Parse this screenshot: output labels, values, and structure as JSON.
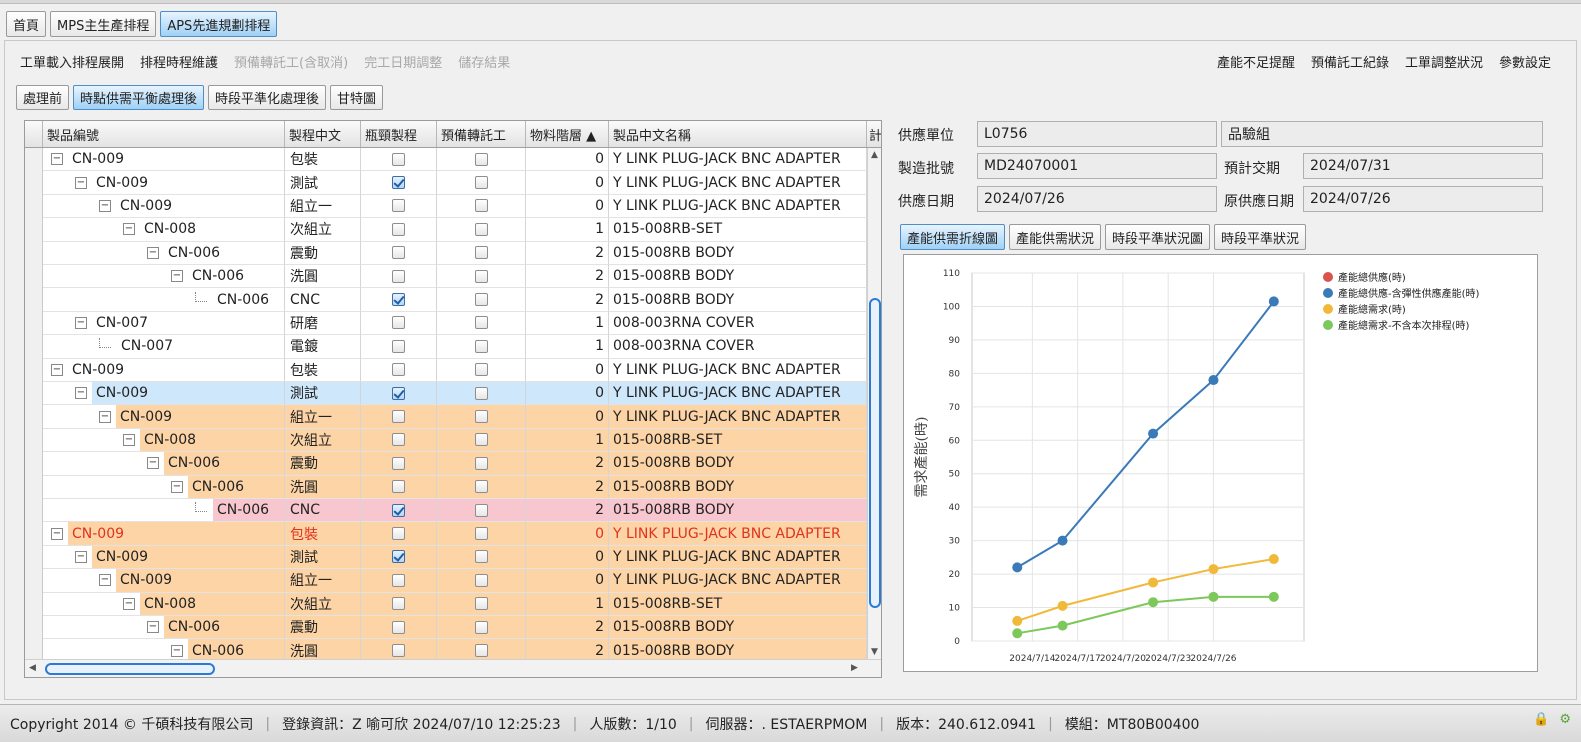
{
  "main_tabs": [
    "首頁",
    "MPS主生產排程",
    "APS先進規劃排程"
  ],
  "menu_left": [
    {
      "label": "工單載入排程展開",
      "enabled": true
    },
    {
      "label": "排程時程維護",
      "enabled": true
    },
    {
      "label": "預備轉託工(含取消)",
      "enabled": false
    },
    {
      "label": "完工日期調整",
      "enabled": false
    },
    {
      "label": "儲存結果",
      "enabled": false
    }
  ],
  "menu_right": [
    "產能不足提醒",
    "預備託工紀錄",
    "工單調整狀況",
    "參數設定"
  ],
  "sub_tabs": [
    "處理前",
    "時點供需平衡處理後",
    "時段平準化處理後",
    "甘特圖"
  ],
  "grid": {
    "headers": [
      "製品編號",
      "製程中文",
      "瓶頸製程",
      "預備轉託工",
      "物料階層 ▲",
      "製品中文名稱",
      "計"
    ],
    "rows": [
      {
        "prod": "CN-009",
        "depth": 0,
        "node": "exp",
        "proc": "包裝",
        "bottleneck": false,
        "outsource": false,
        "level": "0",
        "name": "Y LINK PLUG-JACK BNC ADAPTER",
        "style": "normal"
      },
      {
        "prod": "CN-009",
        "depth": 1,
        "node": "exp",
        "proc": "測試",
        "bottleneck": true,
        "outsource": false,
        "level": "0",
        "name": "Y LINK PLUG-JACK BNC ADAPTER",
        "style": "normal"
      },
      {
        "prod": "CN-009",
        "depth": 2,
        "node": "exp",
        "proc": "組立一",
        "bottleneck": false,
        "outsource": false,
        "level": "0",
        "name": "Y LINK PLUG-JACK BNC ADAPTER",
        "style": "normal"
      },
      {
        "prod": "CN-008",
        "depth": 3,
        "node": "exp",
        "proc": "次組立",
        "bottleneck": false,
        "outsource": false,
        "level": "1",
        "name": "015-008RB-SET",
        "style": "normal"
      },
      {
        "prod": "CN-006",
        "depth": 4,
        "node": "exp",
        "proc": "震動",
        "bottleneck": false,
        "outsource": false,
        "level": "2",
        "name": "015-008RB BODY",
        "style": "normal"
      },
      {
        "prod": "CN-006",
        "depth": 5,
        "node": "exp",
        "proc": "洗圓",
        "bottleneck": false,
        "outsource": false,
        "level": "2",
        "name": "015-008RB BODY",
        "style": "normal"
      },
      {
        "prod": "CN-006",
        "depth": 6,
        "node": "leaf",
        "proc": "CNC",
        "bottleneck": true,
        "outsource": false,
        "level": "2",
        "name": "015-008RB BODY",
        "style": "normal"
      },
      {
        "prod": "CN-007",
        "depth": 1,
        "node": "exp",
        "proc": "研磨",
        "bottleneck": false,
        "outsource": false,
        "level": "1",
        "name": "008-003RNA COVER",
        "style": "normal"
      },
      {
        "prod": "CN-007",
        "depth": 2,
        "node": "leaf",
        "proc": "電鍍",
        "bottleneck": false,
        "outsource": false,
        "level": "1",
        "name": "008-003RNA COVER",
        "style": "normal"
      },
      {
        "prod": "CN-009",
        "depth": 0,
        "node": "exp",
        "proc": "包裝",
        "bottleneck": false,
        "outsource": false,
        "level": "0",
        "name": "Y LINK PLUG-JACK BNC ADAPTER",
        "style": "normal"
      },
      {
        "prod": "CN-009",
        "depth": 1,
        "node": "exp",
        "proc": "測試",
        "bottleneck": true,
        "outsource": false,
        "level": "0",
        "name": "Y LINK PLUG-JACK BNC ADAPTER",
        "style": "selected"
      },
      {
        "prod": "CN-009",
        "depth": 2,
        "node": "exp",
        "proc": "組立一",
        "bottleneck": false,
        "outsource": false,
        "level": "0",
        "name": "Y LINK PLUG-JACK BNC ADAPTER",
        "style": "orange"
      },
      {
        "prod": "CN-008",
        "depth": 3,
        "node": "exp",
        "proc": "次組立",
        "bottleneck": false,
        "outsource": false,
        "level": "1",
        "name": "015-008RB-SET",
        "style": "orange"
      },
      {
        "prod": "CN-006",
        "depth": 4,
        "node": "exp",
        "proc": "震動",
        "bottleneck": false,
        "outsource": false,
        "level": "2",
        "name": "015-008RB BODY",
        "style": "orange"
      },
      {
        "prod": "CN-006",
        "depth": 5,
        "node": "exp",
        "proc": "洗圓",
        "bottleneck": false,
        "outsource": false,
        "level": "2",
        "name": "015-008RB BODY",
        "style": "orange"
      },
      {
        "prod": "CN-006",
        "depth": 6,
        "node": "leaf",
        "proc": "CNC",
        "bottleneck": true,
        "outsource": false,
        "level": "2",
        "name": "015-008RB BODY",
        "style": "pink"
      },
      {
        "prod": "CN-009",
        "depth": 0,
        "node": "exp",
        "proc": "包裝",
        "bottleneck": false,
        "outsource": false,
        "level": "0",
        "name": "Y LINK PLUG-JACK BNC ADAPTER",
        "style": "red"
      },
      {
        "prod": "CN-009",
        "depth": 1,
        "node": "exp",
        "proc": "測試",
        "bottleneck": true,
        "outsource": false,
        "level": "0",
        "name": "Y LINK PLUG-JACK BNC ADAPTER",
        "style": "orange"
      },
      {
        "prod": "CN-009",
        "depth": 2,
        "node": "exp",
        "proc": "組立一",
        "bottleneck": false,
        "outsource": false,
        "level": "0",
        "name": "Y LINK PLUG-JACK BNC ADAPTER",
        "style": "orange"
      },
      {
        "prod": "CN-008",
        "depth": 3,
        "node": "exp",
        "proc": "次組立",
        "bottleneck": false,
        "outsource": false,
        "level": "1",
        "name": "015-008RB-SET",
        "style": "orange"
      },
      {
        "prod": "CN-006",
        "depth": 4,
        "node": "exp",
        "proc": "震動",
        "bottleneck": false,
        "outsource": false,
        "level": "2",
        "name": "015-008RB BODY",
        "style": "orange"
      },
      {
        "prod": "CN-006",
        "depth": 5,
        "node": "exp",
        "proc": "洗圓",
        "bottleneck": false,
        "outsource": false,
        "level": "2",
        "name": "015-008RB BODY",
        "style": "orange"
      }
    ]
  },
  "form": {
    "supply_unit_label": "供應單位",
    "supply_unit": "L0756",
    "supply_group": "品驗組",
    "batch_label": "製造批號",
    "batch": "MD24070001",
    "due_label": "預計交期",
    "due": "2024/07/31",
    "supply_date_label": "供應日期",
    "supply_date": "2024/07/26",
    "orig_supply_date_label": "原供應日期",
    "orig_supply_date": "2024/07/26"
  },
  "chart_tabs": [
    "產能供需折線圖",
    "產能供需狀況",
    "時段平準狀況圖",
    "時段平準狀況"
  ],
  "chart_data": {
    "type": "line",
    "ylabel": "需求產能(時)",
    "ylim": [
      0,
      110
    ],
    "yticks": [
      0,
      10,
      20,
      30,
      40,
      50,
      60,
      70,
      80,
      90,
      100,
      110
    ],
    "x": [
      "2024/7/14",
      "2024/7/17",
      "2024/7/20",
      "2024/7/23",
      "2024/7/26"
    ],
    "x_positions_days": [
      0,
      3,
      9,
      13,
      17
    ],
    "xlim_days": [
      -3,
      19
    ],
    "xtick_days": [
      1,
      4,
      7,
      10,
      13
    ],
    "grid": true,
    "legend": "top-right",
    "series": [
      {
        "name": "產能總供應(時)",
        "color": "#d9534f",
        "values": []
      },
      {
        "name": "產能總供應-含彈性供應產能(時)",
        "color": "#3a7ab8",
        "values": [
          22,
          30,
          62,
          78,
          101.5
        ]
      },
      {
        "name": "產能總需求(時)",
        "color": "#f0b93a",
        "values": [
          6,
          10.5,
          17.5,
          21.5,
          24.5
        ]
      },
      {
        "name": "產能總需求-不含本次排程(時)",
        "color": "#7cc85a",
        "values": [
          2.3,
          4.6,
          11.6,
          13.2,
          13.2
        ]
      }
    ]
  },
  "status": {
    "copyright": "Copyright 2014 © 千碩科技有限公司",
    "login": "登錄資訊：Z 喻可欣 2024/07/10 12:25:23",
    "users": "人版數：1/10",
    "server": "伺服器：. ESTAERPMOM",
    "version": "版本：240.612.0941",
    "module": "模組：MT80B00400"
  }
}
